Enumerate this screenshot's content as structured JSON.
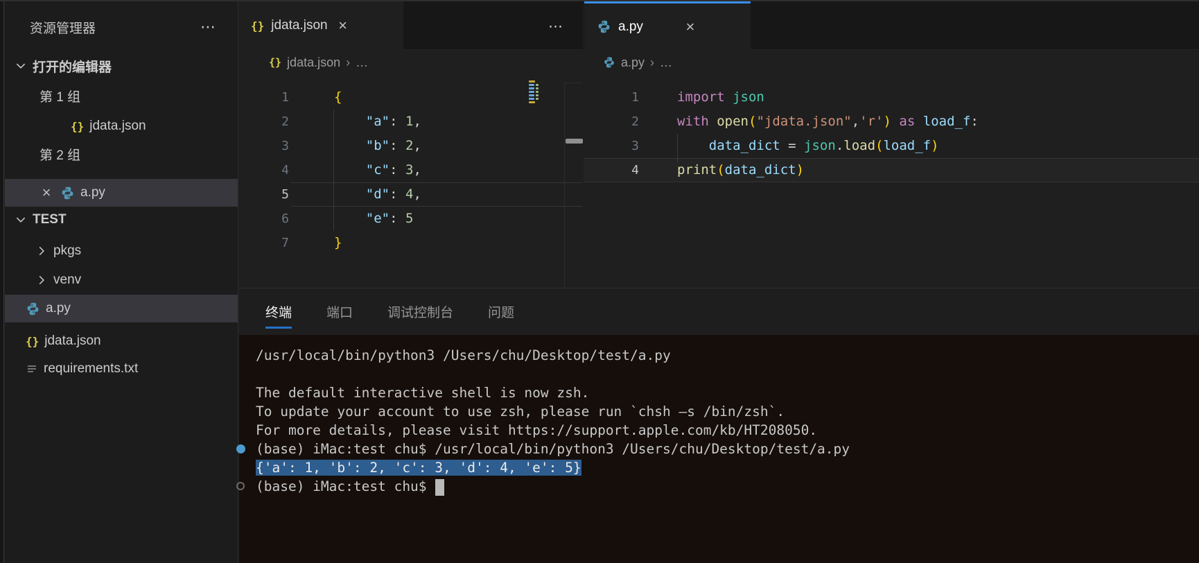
{
  "colors": {
    "accent_tab_top": "#3b8eea",
    "panel_active_underline": "#2472c8",
    "terminal_selection": "#2e5d8f",
    "terminal_decoration_success": "#4b9bd1",
    "json_icon_yellow": "#ded04a",
    "python_icon_blue": "#519aba",
    "selected_row": "#37373d"
  },
  "sidebar": {
    "title": "资源管理器",
    "title_more_icon": "⋯",
    "open_editors": {
      "label": "打开的编辑器",
      "group1_label": "第 1 组",
      "group1_file": "jdata.json",
      "group2_label": "第 2 组",
      "group2_file": "a.py",
      "group2_close_icon": "×"
    },
    "tree": {
      "root": "TEST",
      "folder1": "pkgs",
      "folder2": "venv",
      "file1": "a.py",
      "file2": "jdata.json",
      "file3": "requirements.txt"
    }
  },
  "editor1": {
    "tab_label": "jdata.json",
    "tab_close": "×",
    "tabbar_more_icon": "⋯",
    "breadcrumb_file": "jdata.json",
    "breadcrumb_sep": "›",
    "breadcrumb_more": "…",
    "active_line": 5,
    "lines": [
      [
        [
          "{",
          "brace"
        ]
      ],
      [
        [
          "    ",
          ""
        ],
        [
          "\"a\"",
          "key"
        ],
        [
          ":",
          "punct"
        ],
        [
          " ",
          ""
        ],
        [
          "1",
          "num"
        ],
        [
          ",",
          "punct"
        ]
      ],
      [
        [
          "    ",
          ""
        ],
        [
          "\"b\"",
          "key"
        ],
        [
          ":",
          "punct"
        ],
        [
          " ",
          ""
        ],
        [
          "2",
          "num"
        ],
        [
          ",",
          "punct"
        ]
      ],
      [
        [
          "    ",
          ""
        ],
        [
          "\"c\"",
          "key"
        ],
        [
          ":",
          "punct"
        ],
        [
          " ",
          ""
        ],
        [
          "3",
          "num"
        ],
        [
          ",",
          "punct"
        ]
      ],
      [
        [
          "    ",
          ""
        ],
        [
          "\"d\"",
          "key"
        ],
        [
          ":",
          "punct"
        ],
        [
          " ",
          ""
        ],
        [
          "4",
          "num"
        ],
        [
          ",",
          "punct"
        ]
      ],
      [
        [
          "    ",
          ""
        ],
        [
          "\"e\"",
          "key"
        ],
        [
          ":",
          "punct"
        ],
        [
          " ",
          ""
        ],
        [
          "5",
          "num"
        ]
      ],
      [
        [
          "}",
          "brace"
        ]
      ]
    ],
    "minimap_rows": [
      [
        [
          9,
          "gold"
        ]
      ],
      [
        [
          8,
          "blue"
        ],
        [
          4,
          "green"
        ]
      ],
      [
        [
          8,
          "blue"
        ],
        [
          4,
          "green"
        ]
      ],
      [
        [
          8,
          "blue"
        ],
        [
          4,
          "green"
        ]
      ],
      [
        [
          8,
          "blue"
        ],
        [
          4,
          "green"
        ]
      ],
      [
        [
          8,
          "blue"
        ],
        [
          4,
          "green"
        ]
      ],
      [
        [
          9,
          "gold"
        ]
      ]
    ]
  },
  "editor2": {
    "tab_label": "a.py",
    "tab_close": "×",
    "breadcrumb_file": "a.py",
    "breadcrumb_sep": "›",
    "breadcrumb_more": "…",
    "active_line": 4,
    "lines": [
      [
        [
          "import",
          "kw"
        ],
        [
          " ",
          ""
        ],
        [
          "json",
          "module"
        ]
      ],
      [
        [
          "with",
          "kw"
        ],
        [
          " ",
          ""
        ],
        [
          "open",
          "fn"
        ],
        [
          "(",
          "paren"
        ],
        [
          "\"jdata.json\"",
          "str"
        ],
        [
          ",",
          "punct"
        ],
        [
          "'r'",
          "str"
        ],
        [
          ")",
          "paren"
        ],
        [
          " ",
          ""
        ],
        [
          "as",
          "kw"
        ],
        [
          " ",
          ""
        ],
        [
          "load_f",
          "var"
        ],
        [
          ":",
          "punct"
        ]
      ],
      [
        [
          "    ",
          ""
        ],
        [
          "data_dict",
          "var"
        ],
        [
          " = ",
          "punct"
        ],
        [
          "json",
          "module"
        ],
        [
          ".",
          "punct"
        ],
        [
          "load",
          "fn"
        ],
        [
          "(",
          "paren"
        ],
        [
          "load_f",
          "var"
        ],
        [
          ")",
          "paren"
        ]
      ],
      [
        [
          "print",
          "fn"
        ],
        [
          "(",
          "paren"
        ],
        [
          "data_dict",
          "var"
        ],
        [
          ")",
          "paren"
        ]
      ]
    ]
  },
  "panel": {
    "tabs": [
      {
        "label": "终端",
        "active": true
      },
      {
        "label": "端口",
        "active": false
      },
      {
        "label": "调试控制台",
        "active": false
      },
      {
        "label": "问题",
        "active": false
      }
    ]
  },
  "terminal": {
    "lines": [
      {
        "text": "/usr/local/bin/python3 /Users/chu/Desktop/test/a.py"
      },
      {
        "text": ""
      },
      {
        "text": "The default interactive shell is now zsh."
      },
      {
        "text": "To update your account to use zsh, please run `chsh —s /bin/zsh`."
      },
      {
        "text": "For more details, please visit https://support.apple.com/kb/HT208050."
      },
      {
        "text": "(base) iMac:test chu$ /usr/local/bin/python3 /Users/chu/Desktop/test/a.py",
        "gutter": "filled"
      },
      {
        "text": "{'a': 1, 'b': 2, 'c': 3, 'd': 4, 'e': 5}",
        "selected": true
      },
      {
        "text": "(base) iMac:test chu$ ",
        "gutter": "hollow",
        "cursor": true
      }
    ]
  }
}
